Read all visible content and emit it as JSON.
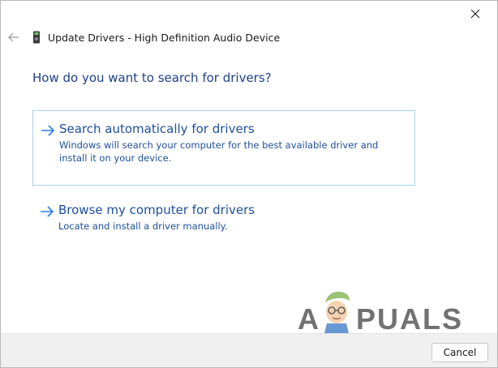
{
  "window": {
    "title": "Update Drivers - High Definition Audio Device"
  },
  "main": {
    "question": "How do you want to search for drivers?",
    "options": [
      {
        "title": "Search automatically for drivers",
        "description": "Windows will search your computer for the best available driver and install it on your device."
      },
      {
        "title": "Browse my computer for drivers",
        "description": "Locate and install a driver manually."
      }
    ]
  },
  "footer": {
    "cancel_label": "Cancel"
  },
  "watermark": {
    "text_left": "A",
    "text_right": "PUALS"
  },
  "icons": {
    "close": "close-icon",
    "back": "back-arrow-icon",
    "device": "audio-device-icon",
    "option_arrow": "right-arrow-icon"
  },
  "colors": {
    "link": "#1e4f9c",
    "heading": "#1e3f8c",
    "selected_border": "#a7d2e8"
  }
}
